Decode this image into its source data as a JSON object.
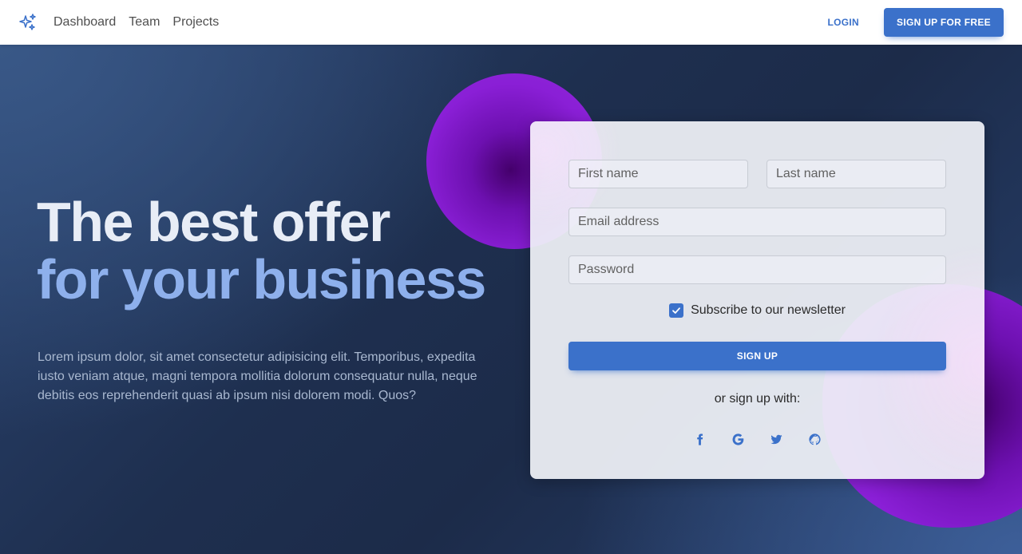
{
  "nav": {
    "brand_icon": "sparkles-icon",
    "links": [
      "Dashboard",
      "Team",
      "Projects"
    ],
    "login_label": "LOGIN",
    "signup_free_label": "SIGN UP FOR FREE"
  },
  "hero": {
    "title_line1": "The best offer",
    "title_line2": "for your business",
    "text": "Lorem ipsum dolor, sit amet consectetur adipisicing elit. Temporibus, expedita iusto veniam atque, magni tempora mollitia dolorum consequatur nulla, neque debitis eos reprehenderit quasi ab ipsum nisi dolorem modi. Quos?"
  },
  "form": {
    "first_name_placeholder": "First name",
    "last_name_placeholder": "Last name",
    "email_placeholder": "Email address",
    "password_placeholder": "Password",
    "subscribe_label": "Subscribe to our newsletter",
    "subscribe_checked": true,
    "signup_label": "SIGN UP",
    "or_text": "or sign up with:",
    "socials": [
      "facebook-icon",
      "google-icon",
      "twitter-icon",
      "github-icon"
    ]
  },
  "colors": {
    "primary": "#3b71ca",
    "title_light": "#e8edf6",
    "title_accent": "#8eb0ec",
    "shape_purple": "#8a1fd6"
  }
}
